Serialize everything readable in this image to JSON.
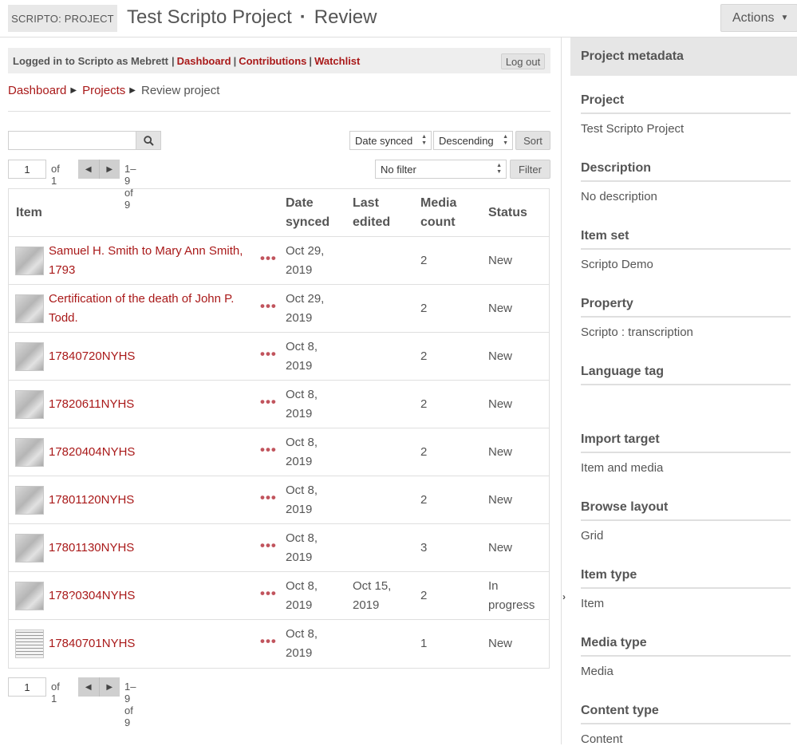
{
  "header": {
    "badge": "SCRIPTO: PROJECT",
    "project_title": "Test Scripto Project",
    "separator": "·",
    "page": "Review",
    "actions_label": "Actions"
  },
  "userbar": {
    "logged_in_text": "Logged in to Scripto as Mebrett",
    "pipe": "|",
    "dashboard": "Dashboard",
    "contributions": "Contributions",
    "watchlist": "Watchlist",
    "logout": "Log out"
  },
  "breadcrumb": {
    "dashboard": "Dashboard",
    "projects": "Projects",
    "current": "Review project"
  },
  "controls": {
    "search_value": "",
    "sort_by": "Date synced",
    "sort_order": "Descending",
    "sort_label": "Sort",
    "filter_value": "No filter",
    "filter_label": "Filter"
  },
  "pager": {
    "page": "1",
    "of": "of 1",
    "range": "1–9 of 9"
  },
  "table": {
    "headers": {
      "item": "Item",
      "date_synced": [
        "Date",
        "synced"
      ],
      "last_edited": [
        "Last",
        "edited"
      ],
      "media_count": [
        "Media",
        "count"
      ],
      "status": "Status"
    },
    "rows": [
      {
        "title": [
          "Samuel H. Smith to Mary Ann Smith,",
          "1793"
        ],
        "date": [
          "Oct 29,",
          "2019"
        ],
        "edited": [
          "",
          ""
        ],
        "media": "2",
        "status": [
          "New"
        ],
        "thumb": "doc"
      },
      {
        "title": [
          "Certification of the death of John P.",
          "Todd."
        ],
        "date": [
          "Oct 29,",
          "2019"
        ],
        "edited": [
          "",
          ""
        ],
        "media": "2",
        "status": [
          "New"
        ],
        "thumb": "doc"
      },
      {
        "title": [
          "17840720NYHS"
        ],
        "date": [
          "Oct 8,",
          "2019"
        ],
        "edited": [
          "",
          ""
        ],
        "media": "2",
        "status": [
          "New"
        ],
        "thumb": "doc"
      },
      {
        "title": [
          "17820611NYHS"
        ],
        "date": [
          "Oct 8,",
          "2019"
        ],
        "edited": [
          "",
          ""
        ],
        "media": "2",
        "status": [
          "New"
        ],
        "thumb": "doc"
      },
      {
        "title": [
          "17820404NYHS"
        ],
        "date": [
          "Oct 8,",
          "2019"
        ],
        "edited": [
          "",
          ""
        ],
        "media": "2",
        "status": [
          "New"
        ],
        "thumb": "doc"
      },
      {
        "title": [
          "17801120NYHS"
        ],
        "date": [
          "Oct 8,",
          "2019"
        ],
        "edited": [
          "",
          ""
        ],
        "media": "2",
        "status": [
          "New"
        ],
        "thumb": "doc"
      },
      {
        "title": [
          "17801130NYHS"
        ],
        "date": [
          "Oct 8,",
          "2019"
        ],
        "edited": [
          "",
          ""
        ],
        "media": "3",
        "status": [
          "New"
        ],
        "thumb": "doc"
      },
      {
        "title": [
          "178?0304NYHS"
        ],
        "date": [
          "Oct 8,",
          "2019"
        ],
        "edited": [
          "Oct 15,",
          "2019"
        ],
        "media": "2",
        "status": [
          "In",
          "progress"
        ],
        "thumb": "doc"
      },
      {
        "title": [
          "17840701NYHS"
        ],
        "date": [
          "Oct 8,",
          "2019"
        ],
        "edited": [
          "",
          ""
        ],
        "media": "1",
        "status": [
          "New"
        ],
        "thumb": "light"
      }
    ],
    "more_icon": "•••"
  },
  "sidebar": {
    "heading": "Project metadata",
    "collapse_icon": "›",
    "fields": [
      {
        "label": "Project",
        "value": "Test Scripto Project",
        "link": true
      },
      {
        "label": "Description",
        "value": "No description",
        "link": false
      },
      {
        "label": "Item set",
        "value": "Scripto Demo",
        "link": true
      },
      {
        "label": "Property",
        "value": "Scripto : transcription",
        "link": false
      },
      {
        "label": "Language tag",
        "value": "",
        "link": false
      },
      {
        "label": "Import target",
        "value": "Item and media",
        "link": false
      },
      {
        "label": "Browse layout",
        "value": "Grid",
        "link": false
      },
      {
        "label": "Item type",
        "value": "Item",
        "link": false
      },
      {
        "label": "Media type",
        "value": "Media",
        "link": false
      },
      {
        "label": "Content type",
        "value": "Content",
        "link": false
      }
    ]
  },
  "icons": {
    "search": "search-icon",
    "prev": "◀",
    "next": "▶",
    "caret": "▼",
    "breadcrumb_sep": "▶"
  },
  "colors": {
    "link": "#a91919",
    "more_dots": "#c1545d"
  }
}
